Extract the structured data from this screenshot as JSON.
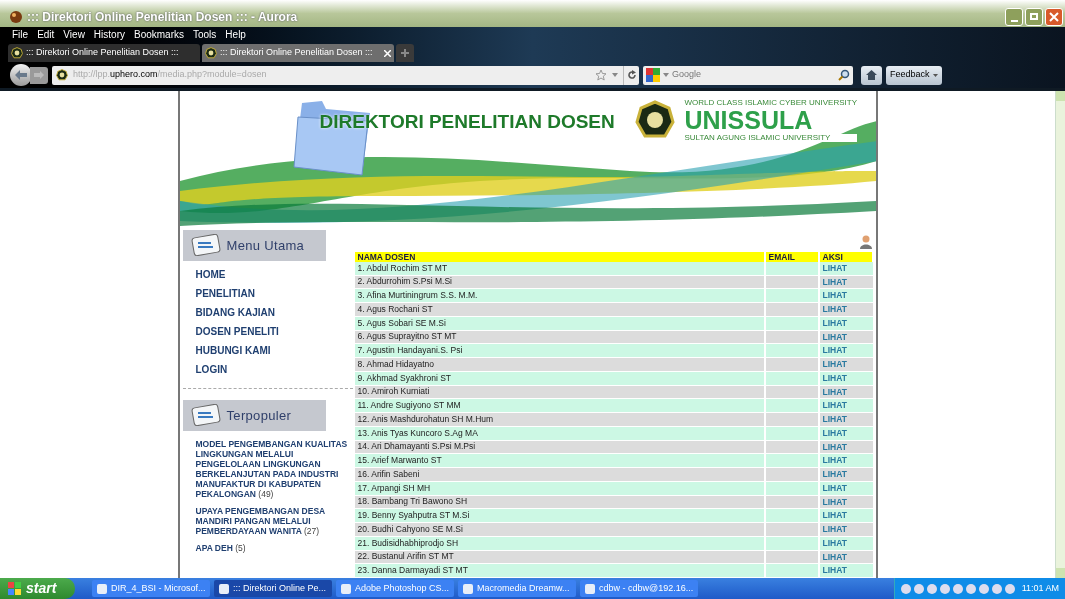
{
  "window": {
    "title": "::: Direktori Online Penelitian Dosen ::: - Aurora"
  },
  "menu": [
    "File",
    "Edit",
    "View",
    "History",
    "Bookmarks",
    "Tools",
    "Help"
  ],
  "tabs": [
    {
      "label": "::: Direktori Online Penelitian Dosen :::",
      "selected": false
    },
    {
      "label": "::: Direktori Online Penelitian Dosen :::",
      "selected": true
    }
  ],
  "address": {
    "value_host_prefix": "http://lpp.",
    "value_host": "uphero.com",
    "value_path": "/media.php?module=dosen"
  },
  "search": {
    "placeholder": "Google"
  },
  "feedback_button": "Feedback",
  "banner": {
    "title": "DIREKTORI PENELITIAN DOSEN",
    "tagline": "WORLD CLASS ISLAMIC CYBER UNIVERSITY",
    "brand": "UNISSULA",
    "subtitle": "SULTAN AGUNG ISLAMIC UNIVERSITY"
  },
  "sidebar": {
    "menu_heading": "Menu Utama",
    "items": [
      "HOME",
      "PENELITIAN",
      "BIDANG KAJIAN",
      "DOSEN PENELITI",
      "HUBUNGI KAMI",
      "LOGIN"
    ],
    "popular_heading": "Terpopuler",
    "popular": [
      {
        "title": "MODEL PENGEMBANGAN KUALITAS LINGKUNGAN MELALUI PENGELOLAAN LINGKUNGAN BERKELANJUTAN PADA INDUSTRI MANUFAKTUR DI KABUPATEN PEKALONGAN",
        "count": "(49)"
      },
      {
        "title": "UPAYA PENGEMBANGAN DESA MANDIRI PANGAN MELALUI PEMBERDAYAAN WANITA",
        "count": "(27)"
      },
      {
        "title": "APA DEH",
        "count": "(5)"
      }
    ]
  },
  "table": {
    "columns": [
      "NAMA DOSEN",
      "EMAIL",
      "AKSI"
    ],
    "rows": [
      {
        "name": "1. Abdul Rochim ST MT",
        "action": "LIHAT"
      },
      {
        "name": "2. Abdurrohim S.Psi M.Si",
        "action": "LIHAT"
      },
      {
        "name": "3. Afina Murtiningrum S.S. M.M.",
        "action": "LIHAT"
      },
      {
        "name": "4. Agus Rochani ST",
        "action": "LIHAT"
      },
      {
        "name": "5. Agus Sobari SE M.Si",
        "action": "LIHAT"
      },
      {
        "name": "6. Agus Suprayitno ST MT",
        "action": "LIHAT"
      },
      {
        "name": "7. Agustin Handayani.S. Psi",
        "action": "LIHAT"
      },
      {
        "name": "8. Ahmad Hidayatno",
        "action": "LIHAT"
      },
      {
        "name": "9. Akhmad Syakhroni ST",
        "action": "LIHAT"
      },
      {
        "name": "10. Amiroh Kurniati",
        "action": "LIHAT"
      },
      {
        "name": "11. Andre Sugiyono ST MM",
        "action": "LIHAT"
      },
      {
        "name": "12. Anis Mashdurohatun SH M.Hum",
        "action": "LIHAT"
      },
      {
        "name": "13. Anis Tyas Kuncoro S.Ag MA",
        "action": "LIHAT"
      },
      {
        "name": "14. Ari Dhamayanti S.Psi M.Psi",
        "action": "LIHAT"
      },
      {
        "name": "15. Arief Marwanto ST",
        "action": "LIHAT"
      },
      {
        "name": "16. Arifin Sabeni",
        "action": "LIHAT"
      },
      {
        "name": "17. Arpangi SH MH",
        "action": "LIHAT"
      },
      {
        "name": "18. Bambang Tri Bawono SH",
        "action": "LIHAT"
      },
      {
        "name": "19. Benny Syahputra ST M.Si",
        "action": "LIHAT"
      },
      {
        "name": "20. Budhi Cahyono SE M.Si",
        "action": "LIHAT"
      },
      {
        "name": "21. Budisidhabhiprodjo SH",
        "action": "LIHAT"
      },
      {
        "name": "22. Bustanul Arifin ST MT",
        "action": "LIHAT"
      },
      {
        "name": "23. Danna Darmayadi ST MT",
        "action": "LIHAT"
      }
    ]
  },
  "taskbar": {
    "start": "start",
    "items": [
      {
        "label": "DIR_4_BSI - Microsof...",
        "selected": false
      },
      {
        "label": "::: Direktori Online Pe...",
        "selected": true
      },
      {
        "label": "Adobe Photoshop CS...",
        "selected": false
      },
      {
        "label": "Macromedia Dreamw...",
        "selected": false
      },
      {
        "label": "cdbw - cdbw@192.16...",
        "selected": false
      }
    ],
    "clock": "11:01 AM"
  }
}
